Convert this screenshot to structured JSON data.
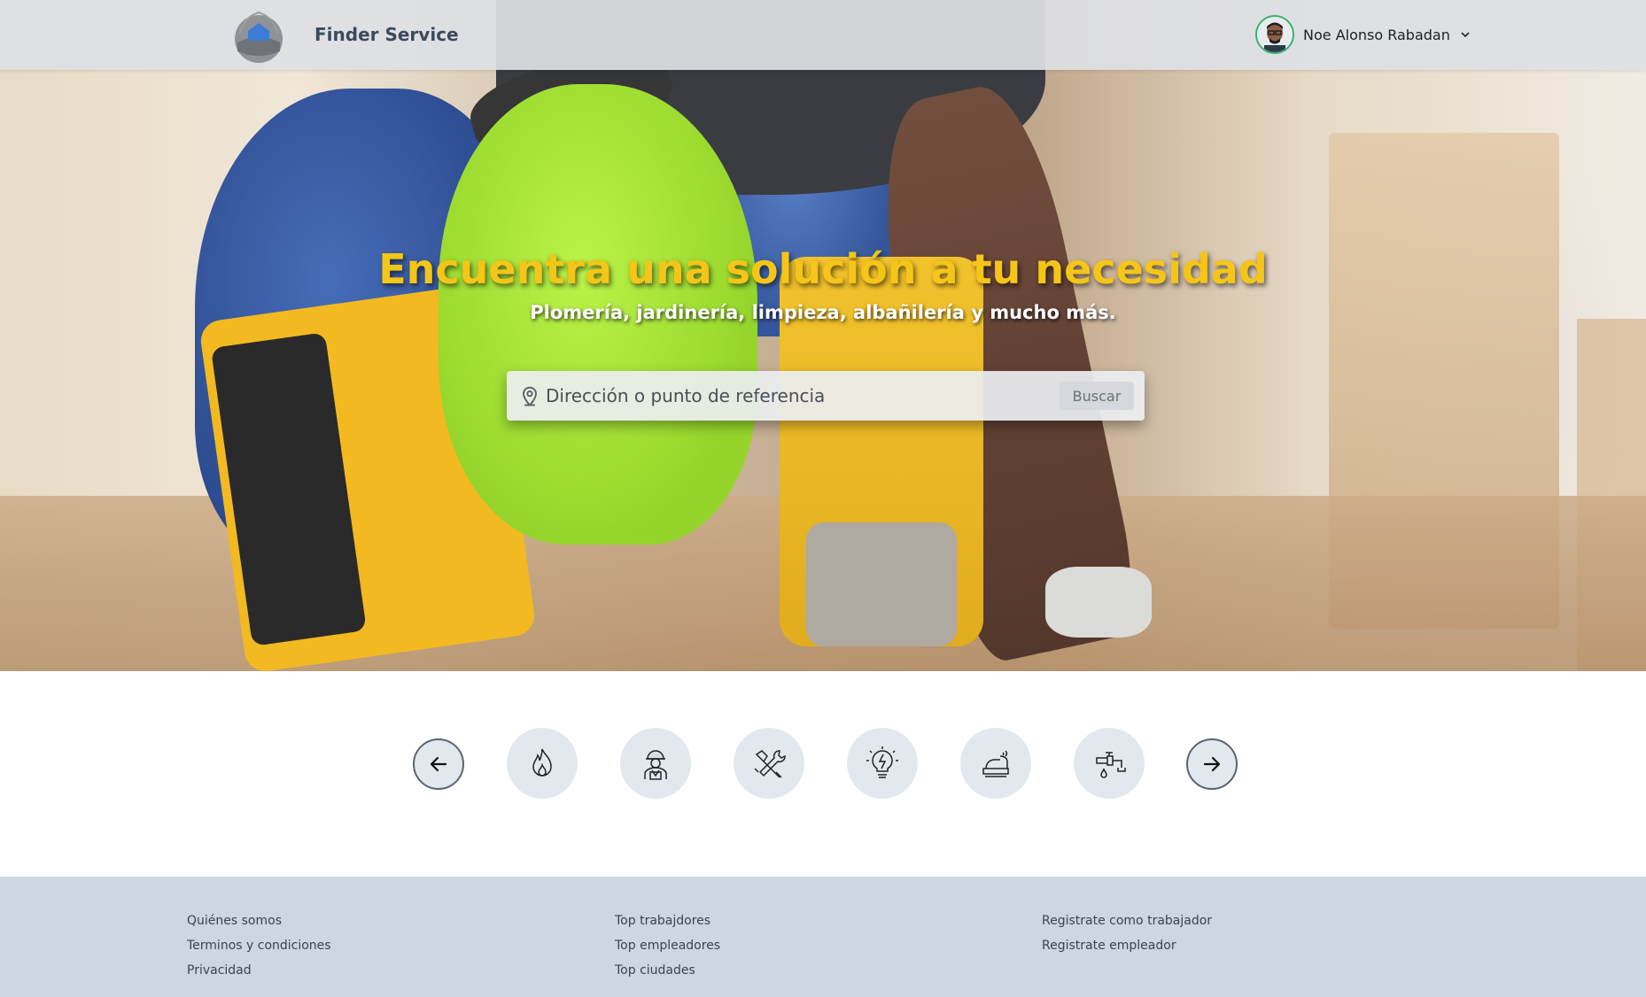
{
  "header": {
    "brand": "Finder Service",
    "user_name": "Noe Alonso Rabadan"
  },
  "hero": {
    "title": "Encuentra una solución a tu necesidad",
    "subtitle": "Plomería, jardinería, limpieza, albañilería y mucho más.",
    "search_placeholder": "Dirección o punto de referencia",
    "search_button": "Buscar"
  },
  "categories": {
    "items": [
      {
        "icon": "fire-icon"
      },
      {
        "icon": "worker-icon"
      },
      {
        "icon": "tools-icon"
      },
      {
        "icon": "lightbulb-icon"
      },
      {
        "icon": "cleaning-icon"
      },
      {
        "icon": "plumbing-icon"
      }
    ]
  },
  "footer": {
    "col1": [
      "Quiénes somos",
      "Terminos y condiciones",
      "Privacidad"
    ],
    "col2": [
      "Top trabajdores",
      "Top empleadores",
      "Top ciudades"
    ],
    "col3": [
      "Registrate como trabajador",
      "Registrate empleador"
    ]
  },
  "colors": {
    "title": "#f5c518",
    "footer_bg": "#cdd6e2",
    "header_bg": "#dee0e4",
    "avatar_ring": "#33b36b"
  }
}
